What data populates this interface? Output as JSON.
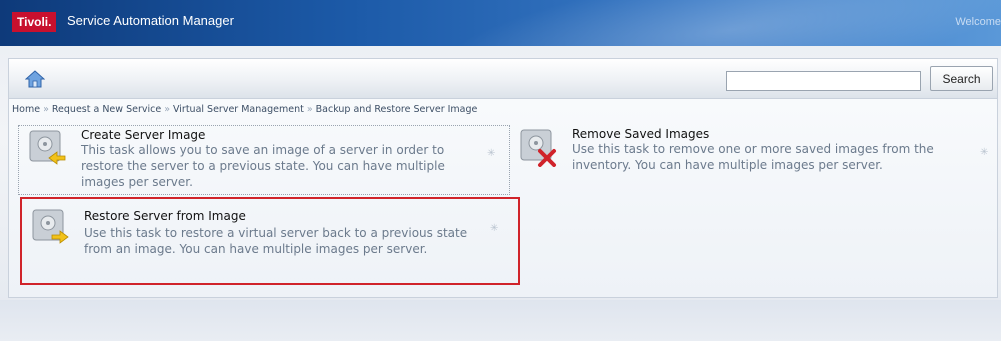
{
  "header": {
    "logo_text": "Tivoli.",
    "app_title": "Service Automation Manager",
    "welcome": "Welcome"
  },
  "toolbar": {
    "home_icon": "home-icon",
    "search_placeholder": "",
    "search_label": "Search"
  },
  "breadcrumb": {
    "items": [
      "Home",
      "Request a New Service",
      "Virtual Server Management",
      "Backup and Restore Server Image"
    ],
    "separator": "»"
  },
  "tasks": [
    {
      "title": "Create Server Image",
      "description": "This task allows you to save an image of a server in order to restore the server to a previous state. You can have multiple images per server.",
      "icon": "create-image-icon"
    },
    {
      "title": "Remove Saved Images",
      "description": "Use this task to remove one or more saved images from the inventory. You can have multiple images per server.",
      "icon": "remove-image-icon"
    },
    {
      "title": "Restore Server from Image",
      "description": "Use this task to restore a virtual server back to a previous state from an image. You can have multiple images per server.",
      "icon": "restore-image-icon",
      "highlighted": true
    }
  ],
  "colors": {
    "brand_red": "#c8102e",
    "highlight_border": "#d0232a",
    "banner_dark": "#0e3a7a",
    "banner_light": "#5a98d8"
  }
}
